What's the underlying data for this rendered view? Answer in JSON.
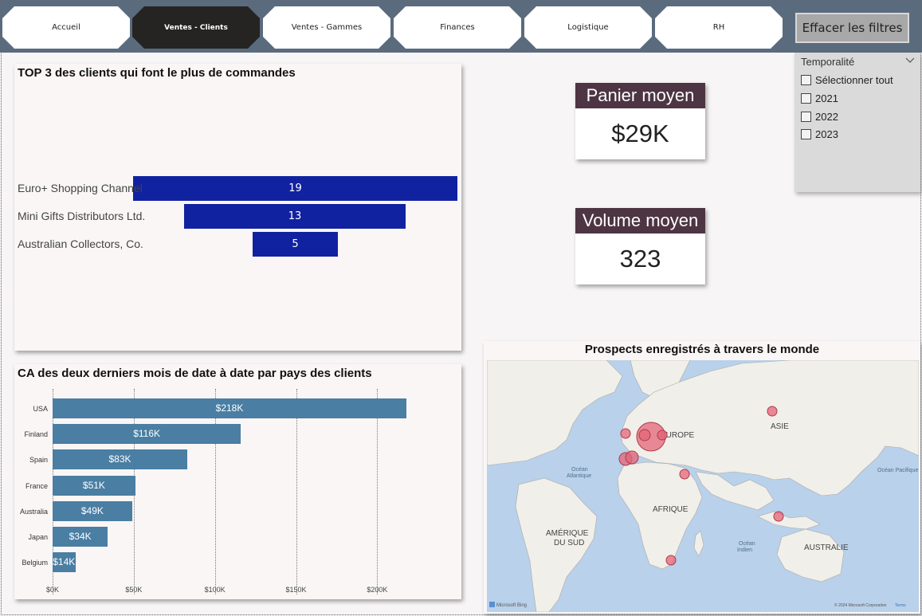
{
  "nav": {
    "tabs": [
      {
        "label": "Accueil",
        "active": false
      },
      {
        "label": "Ventes - Clients",
        "active": true
      },
      {
        "label": "Ventes - Gammes",
        "active": false
      },
      {
        "label": "Finances",
        "active": false
      },
      {
        "label": "Logistique",
        "active": false
      },
      {
        "label": "RH",
        "active": false
      }
    ],
    "clear_filters": "Effacer les filtres"
  },
  "funnel": {
    "title": "TOP 3 des clients qui font le plus de commandes",
    "items": [
      {
        "label": "Euro+ Shopping Channel",
        "value": "19"
      },
      {
        "label": "Mini Gifts Distributors Ltd.",
        "value": "13"
      },
      {
        "label": "Australian Collectors, Co.",
        "value": "5"
      }
    ]
  },
  "kpis": [
    {
      "title": "Panier moyen",
      "value": "$29K"
    },
    {
      "title": "Volume moyen",
      "value": "323"
    }
  ],
  "slicer": {
    "title": "Temporalité",
    "items": [
      "Sélectionner tout",
      "2021",
      "2022",
      "2023"
    ]
  },
  "chart_data": {
    "type": "bar",
    "orientation": "horizontal",
    "title": "CA des deux derniers mois de date à date par pays des clients",
    "categories": [
      "USA",
      "Finland",
      "Spain",
      "France",
      "Australia",
      "Japan",
      "Belgium"
    ],
    "values": [
      218,
      116,
      83,
      51,
      49,
      34,
      14
    ],
    "value_labels": [
      "$218K",
      "$116K",
      "$83K",
      "$51K",
      "$49K",
      "$34K",
      "$14K"
    ],
    "x_ticks": [
      "$0K",
      "$50K",
      "$100K",
      "$150K",
      "$200K"
    ],
    "x_tick_values": [
      0,
      50,
      100,
      150,
      200
    ],
    "xlim": [
      0,
      218
    ],
    "grid": true,
    "color": "#4a7ea3"
  },
  "map": {
    "title": "Prospects enregistrés à travers le monde",
    "labels": {
      "europe": "EUROPE",
      "asie": "ASIE",
      "afrique": "AFRIQUE",
      "amerique1": "AMÉRIQUE",
      "amerique2": "DU SUD",
      "australie": "AUSTRALIE",
      "atl1": "Océan",
      "atl2": "Atlantique",
      "pacifique": "Océan Pacifique",
      "ind1": "Océan",
      "ind2": "Indien"
    },
    "bing": "Microsoft Bing",
    "copyright": "© 2024 Microsoft Corporation",
    "terms": "Terms"
  }
}
